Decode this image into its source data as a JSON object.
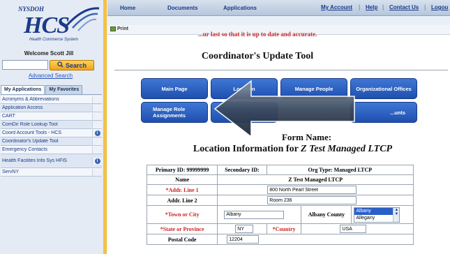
{
  "logo": {
    "org": "NYSDOH",
    "name": "HCS",
    "subtitle": "Health Commerce System"
  },
  "sidebar": {
    "welcome": "Welcome Scott Jill",
    "search_value": "",
    "search_button": "Search",
    "advanced_search": "Advanced Search",
    "tabs": [
      {
        "label": "My Applications",
        "active": true
      },
      {
        "label": "My Favorites",
        "active": false
      }
    ],
    "apps": [
      {
        "label": "Acronyms & Abbreviations",
        "info": false
      },
      {
        "label": "Application Access",
        "info": false
      },
      {
        "label": "CART",
        "info": false
      },
      {
        "label": "ComDir Role Lookup Tool",
        "info": false
      },
      {
        "label": "Coord Account Tools - HCS",
        "info": true
      },
      {
        "label": "Coordinator's Update Tool",
        "info": false
      },
      {
        "label": "Emergency Contacts",
        "info": false
      },
      {
        "label": "Health Facilites Info Sys HFIS",
        "info": true
      },
      {
        "label": "ServNY",
        "info": false
      }
    ]
  },
  "topnav": {
    "items": [
      "Home",
      "Documents",
      "Applications"
    ],
    "links": [
      "My Account",
      "Help",
      "Contact Us",
      "Logou"
    ]
  },
  "toolbar": {
    "print_label": "Print"
  },
  "content": {
    "red_notice": "...ur last so that it is up to date and accurate.",
    "page_title": "Coordinator's Update Tool",
    "menu_buttons": [
      "Main Page",
      "Location",
      "Manage People",
      "Organizational Offices",
      "Manage Role Assignments",
      "...unts"
    ],
    "form_name_label": "Form Name:",
    "form_location_prefix": "Location Information for",
    "form_location_name": "Z Test Managed LTCP"
  },
  "form": {
    "primary_id_label": "Primary ID: 99999999",
    "secondary_id_label": "Secondary ID:",
    "org_type_label": "Org Type: Managed LTCP",
    "name_label": "Name",
    "name_value": "Z Test Managed LTCP",
    "addr1_label": "*Addr. Line 1",
    "addr1_value": "800 North Pearl Street",
    "addr2_label": "Addr. Line 2",
    "addr2_value": "Room 236",
    "town_label": "*Town or City",
    "town_value": "Albany",
    "county_label": "Albany County",
    "county_options": [
      "Albany",
      "Allegany"
    ],
    "state_label": "*State or Province",
    "state_value": "NY",
    "country_label": "*Country",
    "country_value": "USA",
    "postal_label": "Postal Code",
    "postal_value": "12204"
  },
  "colors": {
    "accent": "#1f4fb0",
    "required": "#cc2222",
    "search_button": "#f0a418"
  }
}
